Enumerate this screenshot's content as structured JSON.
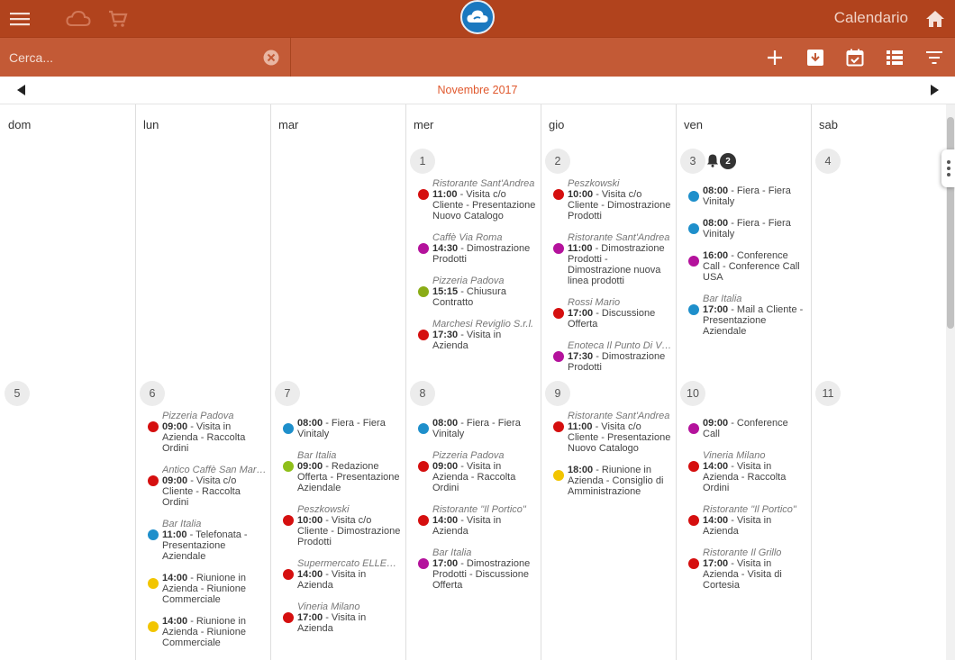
{
  "header": {
    "title": "Calendario"
  },
  "search": {
    "placeholder": "Cerca..."
  },
  "calendar": {
    "month_title": "Novembre 2017",
    "weekdays": [
      "dom",
      "lun",
      "mar",
      "mer",
      "gio",
      "ven",
      "sab"
    ],
    "notification_count": "2",
    "days": [
      {
        "num": "1",
        "events": [
          {
            "loc": "Ristorante Sant'Andrea",
            "time": "11:00",
            "text": " - Visita c/o Cliente - Presentazione Nuovo Catalogo",
            "color": "#d50f0f"
          },
          {
            "loc": "Caffè Via Roma",
            "time": "14:30",
            "text": " - Dimostrazione Prodotti",
            "color": "#b4129c"
          },
          {
            "loc": "Pizzeria Padova",
            "time": "15:15",
            "text": " - Chiusura Contratto",
            "color": "#8aac16"
          },
          {
            "loc": "Marchesi Reviglio S.r.l.",
            "time": "17:30",
            "text": " - Visita in Azienda",
            "color": "#d50f0f"
          }
        ]
      },
      {
        "num": "2",
        "events": [
          {
            "loc": "Peszkowski",
            "time": "10:00",
            "text": " - Visita c/o Cliente - Dimostrazione Prodotti",
            "color": "#d50f0f"
          },
          {
            "loc": "Ristorante Sant'Andrea",
            "time": "11:00",
            "text": " - Dimostrazione Prodotti - Dimostrazione nuova linea prodotti",
            "color": "#b4129c"
          },
          {
            "loc": "Rossi Mario",
            "time": "17:00",
            "text": " - Discussione Offerta",
            "color": "#d50f0f"
          },
          {
            "loc": "Enoteca Il Punto Di Vista",
            "time": "17:30",
            "text": " - Dimostrazione Prodotti",
            "color": "#b4129c"
          }
        ]
      },
      {
        "num": "3",
        "events": [
          {
            "loc": "",
            "time": "08:00",
            "text": " - Fiera - Fiera Vinitaly",
            "color": "#1e8fcb"
          },
          {
            "loc": "",
            "time": "08:00",
            "text": " - Fiera - Fiera Vinitaly",
            "color": "#1e8fcb"
          },
          {
            "loc": "",
            "time": "16:00",
            "text": " - Conference Call - Conference Call USA",
            "color": "#b4129c"
          },
          {
            "loc": "Bar Italia",
            "time": "17:00",
            "text": " - Mail a Cliente - Presentazione Aziendale",
            "color": "#1e8fcb"
          }
        ]
      },
      {
        "num": "4",
        "events": []
      },
      {
        "num": "5",
        "events": []
      },
      {
        "num": "6",
        "events": [
          {
            "loc": "Pizzeria Padova",
            "time": "09:00",
            "text": " - Visita in Azienda - Raccolta Ordini",
            "color": "#d50f0f"
          },
          {
            "loc": "Antico Caffè San Marco",
            "time": "09:00",
            "text": " - Visita c/o Cliente - Raccolta Ordini",
            "color": "#d50f0f"
          },
          {
            "loc": "Bar Italia",
            "time": "11:00",
            "text": " - Telefonata - Presentazione Aziendale",
            "color": "#1e8fcb"
          },
          {
            "loc": "",
            "time": "14:00",
            "text": " - Riunione in Azienda - Riunione Commerciale",
            "color": "#f2c500"
          },
          {
            "loc": "",
            "time": "14:00",
            "text": " - Riunione in Azienda - Riunione Commerciale",
            "color": "#f2c500"
          }
        ]
      },
      {
        "num": "7",
        "events": [
          {
            "loc": "",
            "time": "08:00",
            "text": " - Fiera - Fiera Vinitaly",
            "color": "#1e8fcb"
          },
          {
            "loc": "Bar Italia",
            "time": "09:00",
            "text": " - Redazione Offerta - Presentazione Aziendale",
            "color": "#8fbf1a"
          },
          {
            "loc": "Peszkowski",
            "time": "10:00",
            "text": " - Visita c/o Cliente - Dimostrazione Prodotti",
            "color": "#d50f0f"
          },
          {
            "loc": "Supermercato ELLESSE",
            "time": "14:00",
            "text": " - Visita in Azienda",
            "color": "#d50f0f"
          },
          {
            "loc": "Vineria Milano",
            "time": "17:00",
            "text": " - Visita in Azienda",
            "color": "#d50f0f"
          }
        ]
      },
      {
        "num": "8",
        "events": [
          {
            "loc": "",
            "time": "08:00",
            "text": " - Fiera - Fiera Vinitaly",
            "color": "#1e8fcb"
          },
          {
            "loc": "Pizzeria Padova",
            "time": "09:00",
            "text": " - Visita in Azienda - Raccolta Ordini",
            "color": "#d50f0f"
          },
          {
            "loc": "Ristorante \"Il Portico\"",
            "time": "14:00",
            "text": " - Visita in Azienda",
            "color": "#d50f0f"
          },
          {
            "loc": "Bar Italia",
            "time": "17:00",
            "text": " - Dimostrazione Prodotti - Discussione Offerta",
            "color": "#b4129c"
          }
        ]
      },
      {
        "num": "9",
        "events": [
          {
            "loc": "Ristorante Sant'Andrea",
            "time": "11:00",
            "text": " - Visita c/o Cliente - Presentazione Nuovo Catalogo",
            "color": "#d50f0f"
          },
          {
            "loc": "",
            "time": "18:00",
            "text": " - Riunione in Azienda - Consiglio di Amministrazione",
            "color": "#f2c500"
          }
        ]
      },
      {
        "num": "10",
        "events": [
          {
            "loc": "",
            "time": "09:00",
            "text": " - Conference Call",
            "color": "#b4129c"
          },
          {
            "loc": "Vineria Milano",
            "time": "14:00",
            "text": " - Visita in Azienda - Raccolta Ordini",
            "color": "#d50f0f"
          },
          {
            "loc": "Ristorante \"Il Portico\"",
            "time": "14:00",
            "text": " - Visita in Azienda",
            "color": "#d50f0f"
          },
          {
            "loc": "Ristorante Il Grillo",
            "time": "17:00",
            "text": " - Visita in Azienda - Visita di Cortesia",
            "color": "#d50f0f"
          }
        ]
      },
      {
        "num": "11",
        "events": []
      }
    ]
  }
}
